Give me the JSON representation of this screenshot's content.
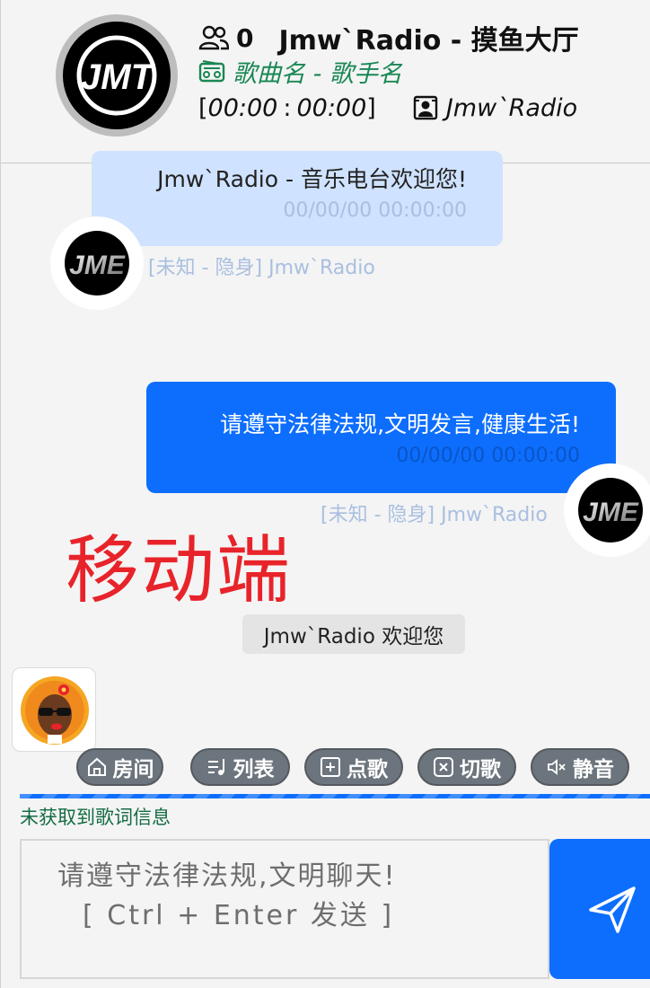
{
  "header": {
    "online_count": "0",
    "room_title": "Jmw`Radio - 摸鱼大厅",
    "song_info": "歌曲名 - 歌手名",
    "bracket_open": "[",
    "time_current": "00:00",
    "time_sep": ":",
    "time_total": "00:00",
    "bracket_close": "]",
    "host_name": "Jmw`Radio",
    "logo_text": "JMT"
  },
  "messages": [
    {
      "text": "Jmw`Radio - 音乐电台欢迎您!",
      "time": "00/00/00 00:00:00",
      "meta": "[未知 - 隐身] Jmw`Radio",
      "avatar_text": "JME"
    },
    {
      "text": "请遵守法律法规,文明发言,健康生活!",
      "time": "00/00/00 00:00:00",
      "meta": "[未知 - 隐身] Jmw`Radio",
      "avatar_text": "JME"
    }
  ],
  "overlay_label": "移动端",
  "system_message": "Jmw`Radio 欢迎您",
  "controls": {
    "room": "房间",
    "playlist": "列表",
    "request": "点歌",
    "skip": "切歌",
    "mute": "静音"
  },
  "lyrics_status": "未获取到歌词信息",
  "chat_input": {
    "placeholder_line1": "请遵守法律法规,文明聊天!",
    "placeholder_line2": "[ Ctrl + Enter 发送 ]"
  },
  "icons": {
    "online": "users-icon",
    "song": "radio-icon",
    "host": "person-badge-icon",
    "room": "house-icon",
    "playlist": "music-list-icon",
    "request": "plus-square-icon",
    "skip": "x-square-icon",
    "mute": "volume-mute-icon",
    "send": "send-icon"
  },
  "colors": {
    "primary": "#0d6efd",
    "light_bubble": "#cfe2ff",
    "success_text": "#198754",
    "pill_gray": "#6c757d",
    "watermark_red": "#e8232a"
  }
}
